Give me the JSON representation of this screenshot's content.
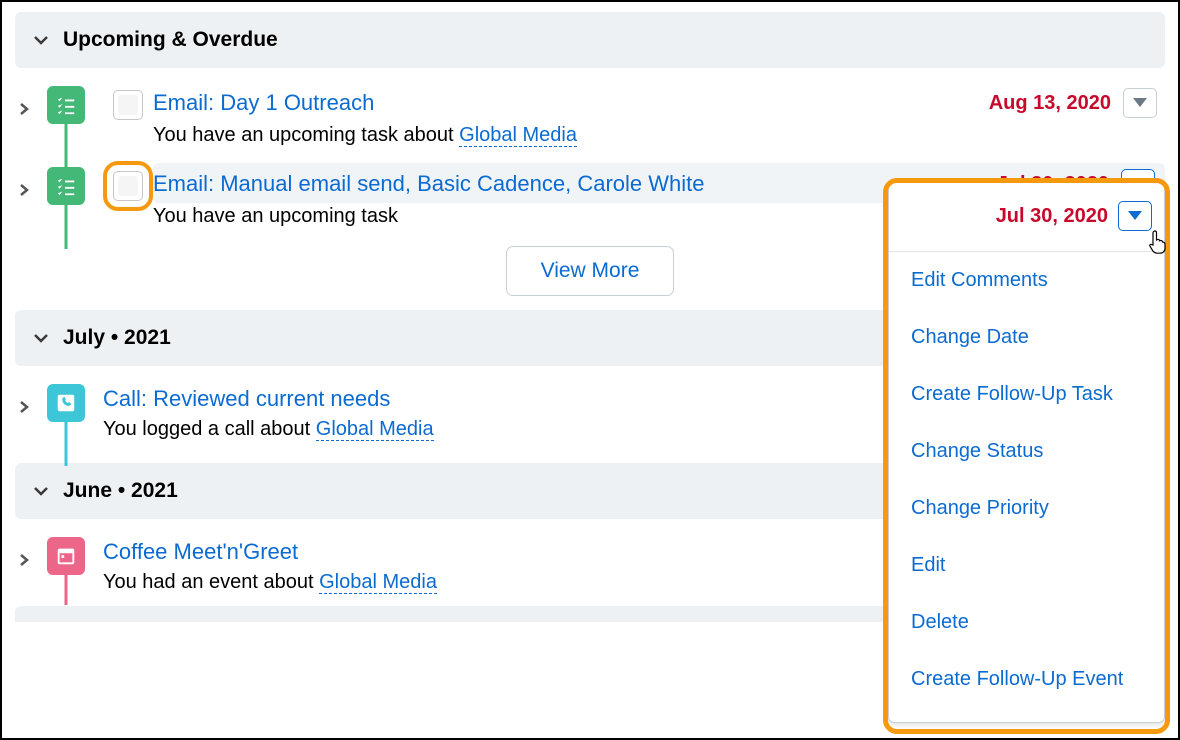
{
  "sections": {
    "upcoming_title": "Upcoming & Overdue",
    "july_title": "July  •  2021",
    "june_title": "June  •  2021"
  },
  "items": {
    "email1": {
      "title": "Email: Day 1 Outreach",
      "subtext_prefix": "You have an upcoming task about ",
      "subtext_link": "Global Media",
      "date": "Aug 13, 2020"
    },
    "email2": {
      "title": "Email: Manual email send, Basic Cadence, Carole White",
      "subtext_prefix": "You have an upcoming task",
      "date": "Jul 30, 2020"
    },
    "call1": {
      "title": "Call: Reviewed current needs",
      "subtext_prefix": "You logged a call about ",
      "subtext_link": "Global Media"
    },
    "event1": {
      "title": "Coffee Meet'n'Greet",
      "subtext_prefix": "You had an event about ",
      "subtext_link": "Global Media"
    }
  },
  "buttons": {
    "view_more": "View More"
  },
  "menu": {
    "date": "Jul 30, 2020",
    "items": {
      "m0": "Edit Comments",
      "m1": "Change Date",
      "m2": "Create Follow-Up Task",
      "m3": "Change Status",
      "m4": "Change Priority",
      "m5": "Edit",
      "m6": "Delete",
      "m7": "Create Follow-Up Event"
    }
  }
}
